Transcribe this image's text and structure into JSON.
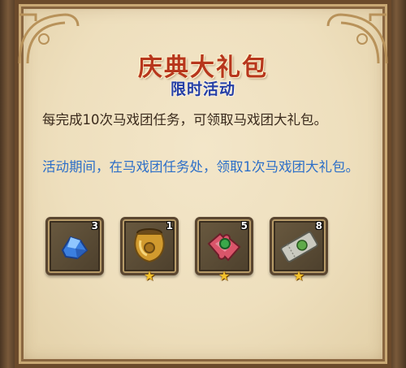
{
  "panel": {
    "title": "庆典大礼包",
    "subtitle": "限时活动",
    "description": "每完成10次马戏团任务，可领取马戏团大礼包。",
    "note": "活动期间，在马戏团任务处，领取1次马戏团大礼包。"
  },
  "rewards": [
    {
      "icon": "blue-crystal-icon",
      "count": "3",
      "stars": 0
    },
    {
      "icon": "golden-pot-icon",
      "count": "1",
      "stars": 1
    },
    {
      "icon": "jigsaw-puzzle-icon",
      "count": "5",
      "stars": 1
    },
    {
      "icon": "ticket-icon",
      "count": "8",
      "stars": 1
    }
  ],
  "colors": {
    "title": "#b7361c",
    "subtitle": "#243ea6",
    "note": "#2d6fc8",
    "parchment": "#eedfbd"
  }
}
